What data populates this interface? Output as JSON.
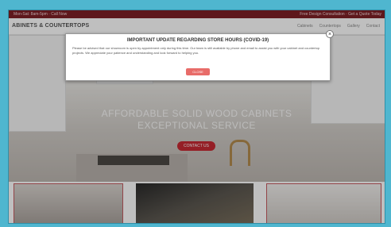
{
  "topbar": {
    "left_text": "Mon-Sat: 8am-5pm  ·  Call Now",
    "right_text": "Free Design Consultation  ·  Get a Quote Today"
  },
  "nav": {
    "logo": "ABINETS & COUNTERTOPS",
    "links": [
      "Cabinets",
      "Countertops",
      "Gallery",
      "Contact"
    ]
  },
  "hero": {
    "title": "AFFORDABLE SOLID WOOD CABINETS",
    "subtitle": "EXCEPTIONAL SERVICE",
    "cta": "CONTACT US"
  },
  "modal": {
    "title": "IMPORTANT UPDATE REGARDING STORE HOURS (COVID-19)",
    "body": "Please be advised that our showroom is open by appointment only during this time. Our team is still available by phone and email to assist you with your cabinet and countertop projects. We appreciate your patience and understanding and look forward to helping you.",
    "button": "CLOSE",
    "close_glyph": "×"
  },
  "icons": {
    "close": "close-icon"
  },
  "colors": {
    "topbar": "#7e2026",
    "accent": "#c72a33",
    "modal_button": "#e86c69",
    "page_border": "#4fb6cf"
  }
}
